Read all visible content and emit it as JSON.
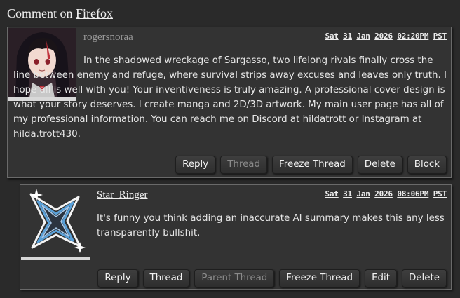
{
  "page": {
    "title_prefix": "Comment on ",
    "title_link": "Firefox"
  },
  "comments": [
    {
      "username": "rogersnoraa",
      "timestamp": {
        "day": "Sat",
        "date": "31",
        "month": "Jan",
        "year": "2026",
        "time": "02:20PM",
        "tz": "PST"
      },
      "text": "In the shadowed wreckage of Sargasso, two lifelong rivals finally cross the line between enemy and refuge, where survival strips away excuses and leaves only truth. I hope all is well with you! Your inventiveness is truly amazing. A professional cover design is what your story deserves. I create manga and 2D/3D artwork. My main user page has all of my professional information. You can reach me on Discord at hildatrott or Instagram at hilda.trott430.",
      "buttons": {
        "reply": "Reply",
        "thread": "Thread",
        "freeze": "Freeze Thread",
        "delete": "Delete",
        "block": "Block"
      }
    },
    {
      "username": "Star_Ringer",
      "timestamp": {
        "day": "Sat",
        "date": "31",
        "month": "Jan",
        "year": "2026",
        "time": "08:06PM",
        "tz": "PST"
      },
      "text": "It's funny you think adding an inaccurate AI summary makes this any less transparently bullshit.",
      "buttons": {
        "reply": "Reply",
        "thread": "Thread",
        "parent": "Parent Thread",
        "freeze": "Freeze Thread",
        "edit": "Edit",
        "delete": "Delete"
      }
    }
  ],
  "colors": {
    "background": "#2a2a2a",
    "panel": "#333333",
    "disabled_text": "#8a8a8a"
  }
}
